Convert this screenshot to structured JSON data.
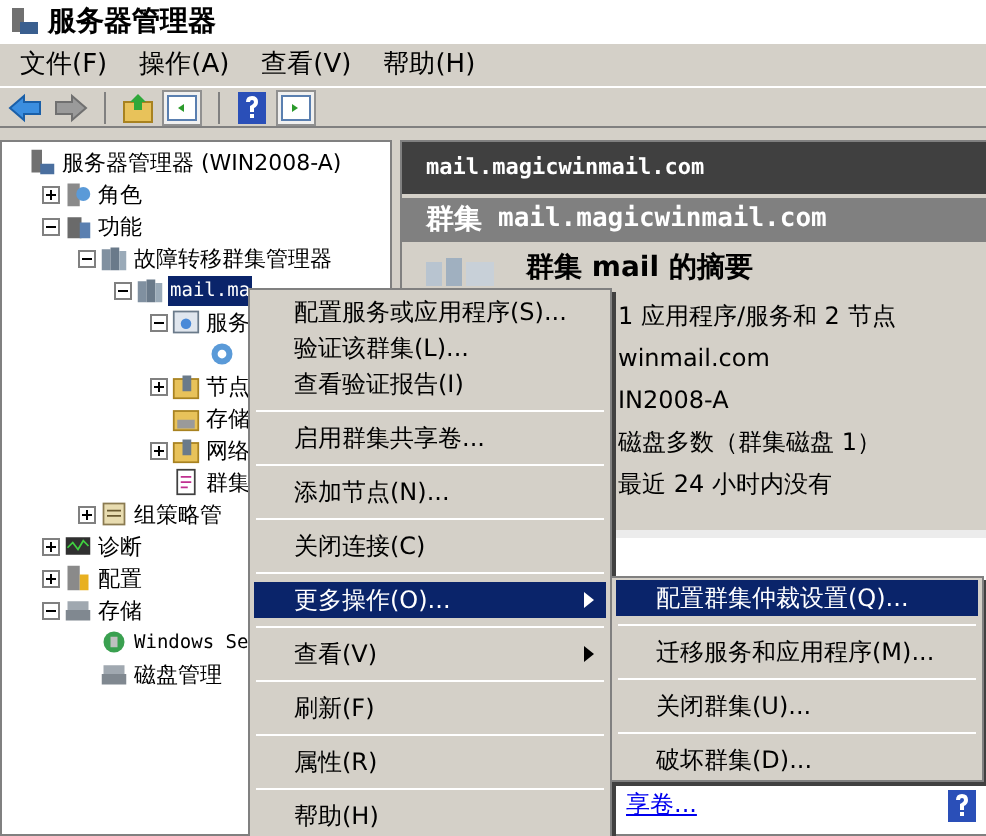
{
  "window": {
    "title": "服务器管理器"
  },
  "menubar": [
    "文件(F)",
    "操作(A)",
    "查看(V)",
    "帮助(H)"
  ],
  "tree": [
    {
      "label": "服务器管理器 (WIN2008-A)",
      "selected": false,
      "children": [
        {
          "label": "角色",
          "expanded": false,
          "selected": false
        },
        {
          "label": "功能",
          "expanded": true,
          "selected": false,
          "children": [
            {
              "label": "故障转移群集管理器",
              "expanded": true,
              "selected": false,
              "children": [
                {
                  "label": "mail.ma",
                  "expanded": true,
                  "selected": true,
                  "children": [
                    {
                      "label": "服务",
                      "expanded": true,
                      "selected": false,
                      "children": [
                        {
                          "selected": false
                        }
                      ]
                    },
                    {
                      "label": "节点",
                      "expanded": false,
                      "selected": false
                    },
                    {
                      "label": "存储",
                      "selected": false
                    },
                    {
                      "label": "网络",
                      "expanded": false,
                      "selected": false
                    },
                    {
                      "label": "群集",
                      "selected": false
                    }
                  ]
                }
              ]
            },
            {
              "label": "组策略管",
              "expanded": false,
              "selected": false
            }
          ]
        },
        {
          "label": "诊断",
          "expanded": false,
          "selected": false
        },
        {
          "label": "配置",
          "expanded": false,
          "selected": false
        },
        {
          "label": "存储",
          "expanded": true,
          "selected": false,
          "children": [
            {
              "label": "Windows Se",
              "selected": false
            },
            {
              "label": "磁盘管理",
              "selected": false
            }
          ]
        }
      ]
    }
  ],
  "right_panel": {
    "header": "mail.magicwinmail.com",
    "title_prefix": "群集",
    "title": "mail.magicwinmail.com",
    "summary_title": "群集 mail 的摘要",
    "lines": [
      "1 应用程序/服务和 2 节点",
      "winmail.com",
      "IN2008-A",
      "磁盘多数（群集磁盘 1）",
      "最近 24 小时内没有"
    ],
    "link": "享卷..."
  },
  "context_menu": {
    "groups": [
      [
        {
          "label": "配置服务或应用程序(S)...",
          "selected": false
        },
        {
          "label": "验证该群集(L)...",
          "selected": false
        },
        {
          "label": "查看验证报告(I)",
          "selected": false
        }
      ],
      [
        {
          "label": "启用群集共享卷...",
          "selected": false
        }
      ],
      [
        {
          "label": "添加节点(N)...",
          "selected": false
        }
      ],
      [
        {
          "label": "关闭连接(C)",
          "selected": false
        }
      ],
      [
        {
          "label": "更多操作(O)...",
          "selected": true,
          "submenu": true
        }
      ],
      [
        {
          "label": "查看(V)",
          "selected": false,
          "submenu": true
        }
      ],
      [
        {
          "label": "刷新(F)",
          "selected": false
        }
      ],
      [
        {
          "label": "属性(R)",
          "selected": false
        }
      ],
      [
        {
          "label": "帮助(H)",
          "selected": false
        }
      ]
    ]
  },
  "submenu": {
    "groups": [
      [
        {
          "label": "配置群集仲裁设置(Q)...",
          "selected": true
        }
      ],
      [
        {
          "label": "迁移服务和应用程序(M)...",
          "selected": false
        }
      ],
      [
        {
          "label": "关闭群集(U)...",
          "selected": false
        }
      ],
      [
        {
          "label": "破坏群集(D)...",
          "selected": false
        }
      ]
    ]
  }
}
